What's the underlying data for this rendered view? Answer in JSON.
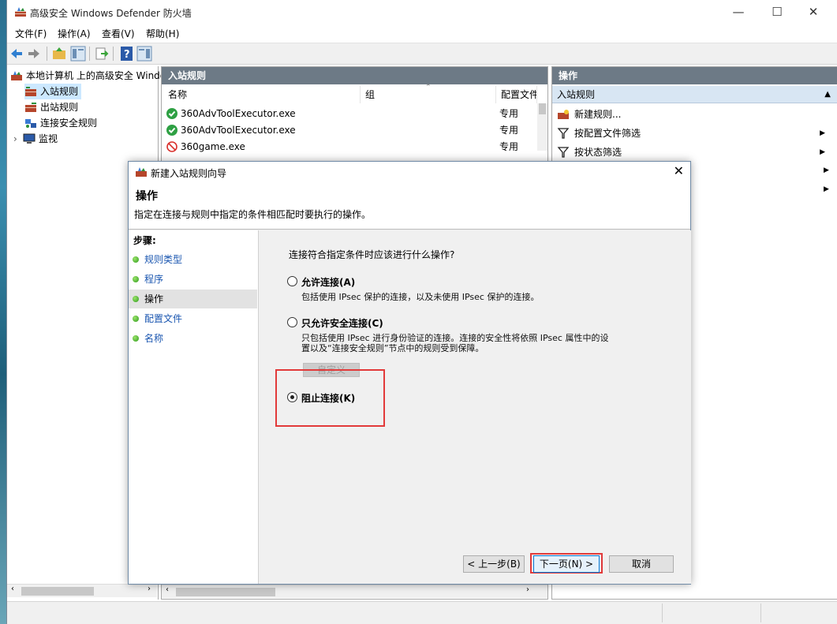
{
  "window": {
    "title": "高级安全 Windows Defender 防火墙",
    "controls": {
      "minimize": "—",
      "maximize": "☐",
      "close": "✕"
    }
  },
  "menubar": {
    "items": [
      "文件(F)",
      "操作(A)",
      "查看(V)",
      "帮助(H)"
    ]
  },
  "toolbar": {
    "icons": [
      "back-arrow-icon",
      "forward-arrow-icon",
      "up-folder-icon",
      "show-hide-tree-icon",
      "export-icon",
      "help-icon",
      "show-hide-action-pane-icon"
    ]
  },
  "tree": {
    "root": "本地计算机 上的高级安全 Windo",
    "items": [
      "入站规则",
      "出站规则",
      "连接安全规则",
      "监视"
    ]
  },
  "middle": {
    "header": "入站规则",
    "columns": [
      "名称",
      "组",
      "配置文件"
    ],
    "rows": [
      {
        "name": "360AdvToolExecutor.exe",
        "group": "",
        "profile": "专用",
        "status": "allow"
      },
      {
        "name": "360AdvToolExecutor.exe",
        "group": "",
        "profile": "专用",
        "status": "allow"
      },
      {
        "name": "360game.exe",
        "group": "",
        "profile": "专用",
        "status": "block"
      }
    ]
  },
  "actions": {
    "header": "操作",
    "section": "入站规则",
    "items": [
      "新建规则...",
      "按配置文件筛选",
      "按状态筛选"
    ]
  },
  "dialog": {
    "title": "新建入站规则向导",
    "heading": "操作",
    "description": "指定在连接与规则中指定的条件相匹配时要执行的操作。",
    "steps_title": "步骤:",
    "steps": [
      "规则类型",
      "程序",
      "操作",
      "配置文件",
      "名称"
    ],
    "question": "连接符合指定条件时应该进行什么操作?",
    "options": [
      {
        "label": "允许连接(A)",
        "desc": [
          "包括使用 IPsec 保护的连接，以及未使用 IPsec 保护的连接。"
        ]
      },
      {
        "label": "只允许安全连接(C)",
        "desc": [
          "只包括使用 IPsec 进行身份验证的连接。连接的安全性将依照 IPsec 属性中的设",
          "置以及“连接安全规则”节点中的规则受到保障。"
        ]
      },
      {
        "label": "阻止连接(K)",
        "desc": []
      }
    ],
    "selected_option": "阻止连接(K)",
    "customize_button": "自定义",
    "back_button": "< 上一步(B)",
    "next_button": "下一页(N) >",
    "cancel_button": "取消",
    "highlight_color": "#e23a3a"
  }
}
